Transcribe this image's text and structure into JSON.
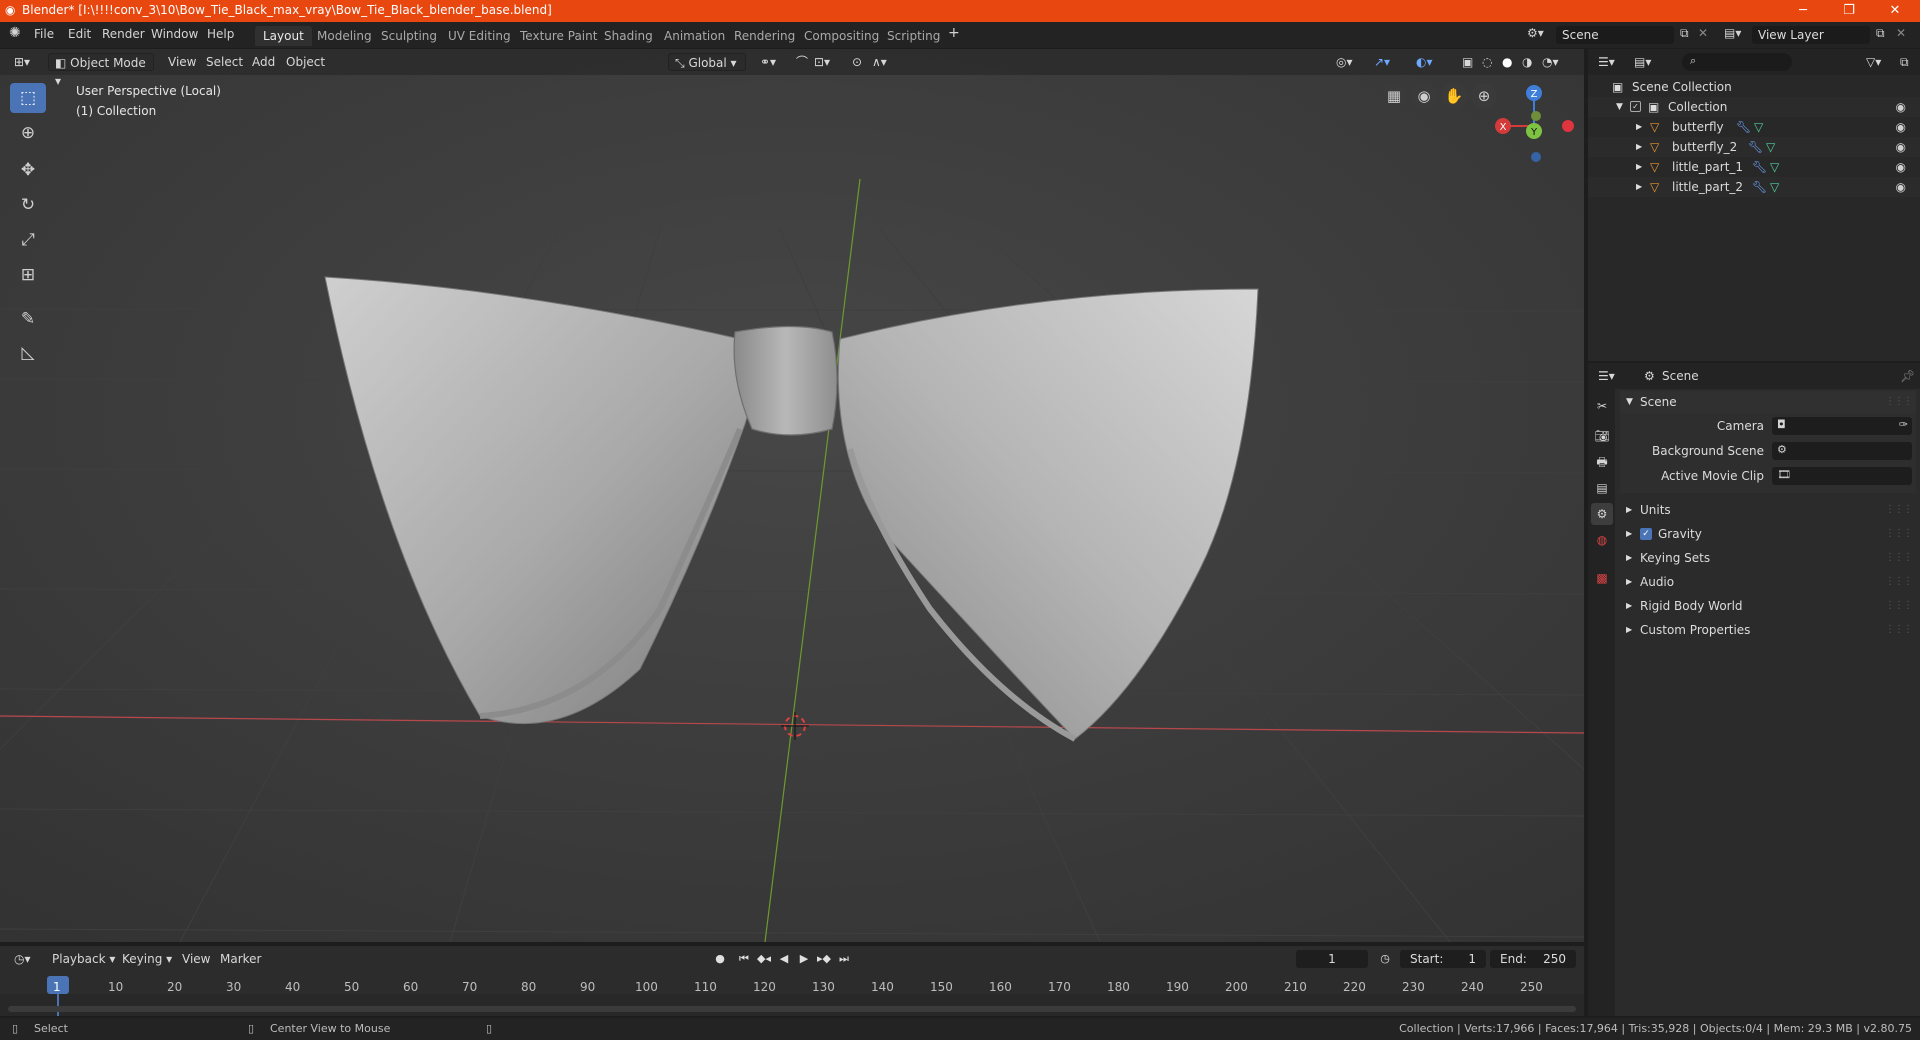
{
  "window": {
    "title": "Blender* [I:\\!!!!conv_3\\10\\Bow_Tie_Black_max_vray\\Bow_Tie_Black_blender_base.blend]"
  },
  "menu": [
    "File",
    "Edit",
    "Render",
    "Window",
    "Help"
  ],
  "workspaces": [
    "Layout",
    "Modeling",
    "Sculpting",
    "UV Editing",
    "Texture Paint",
    "Shading",
    "Animation",
    "Rendering",
    "Compositing",
    "Scripting"
  ],
  "scene_field": "Scene",
  "view_layer_field": "View Layer",
  "viewport": {
    "mode": "Object Mode",
    "menus": [
      "View",
      "Select",
      "Add",
      "Object"
    ],
    "transform_orientation": "Global",
    "perspective_text": "User Perspective (Local)",
    "collection_text": "(1) Collection",
    "gizmo": {
      "x": "X",
      "y": "Y",
      "z": "Z"
    }
  },
  "outliner": {
    "root": "Scene Collection",
    "collection": "Collection",
    "items": [
      "butterfly",
      "butterfly_2",
      "little_part_1",
      "little_part_2"
    ]
  },
  "properties": {
    "context": "Scene",
    "panel_title": "Scene",
    "fields": [
      {
        "label": "Camera"
      },
      {
        "label": "Background Scene"
      },
      {
        "label": "Active Movie Clip"
      }
    ],
    "panels": [
      "Units",
      "Gravity",
      "Keying Sets",
      "Audio",
      "Rigid Body World",
      "Custom Properties"
    ]
  },
  "timeline": {
    "menus": [
      "Playback",
      "Keying",
      "View",
      "Marker"
    ],
    "current_frame": "1",
    "start_label": "Start:",
    "start": "1",
    "end_label": "End:",
    "end": "250",
    "ticks": [
      "1",
      "10",
      "20",
      "30",
      "40",
      "50",
      "60",
      "70",
      "80",
      "90",
      "100",
      "110",
      "120",
      "130",
      "140",
      "150",
      "160",
      "170",
      "180",
      "190",
      "200",
      "210",
      "220",
      "230",
      "240",
      "250"
    ]
  },
  "status": {
    "left": "Select",
    "middle": "Center View to Mouse",
    "right": "Collection | Verts:17,966 | Faces:17,964 | Tris:35,928 | Objects:0/4 | Mem: 29.3 MB | v2.80.75"
  },
  "colors": {
    "titlebar": "#e8470f",
    "accent": "#4a74b5",
    "object_orange": "#e8952c",
    "mesh_green": "#4fcf9a",
    "x_axis": "#d43a3a",
    "y_axis": "#7ec242",
    "z_axis": "#3f7fd9"
  }
}
